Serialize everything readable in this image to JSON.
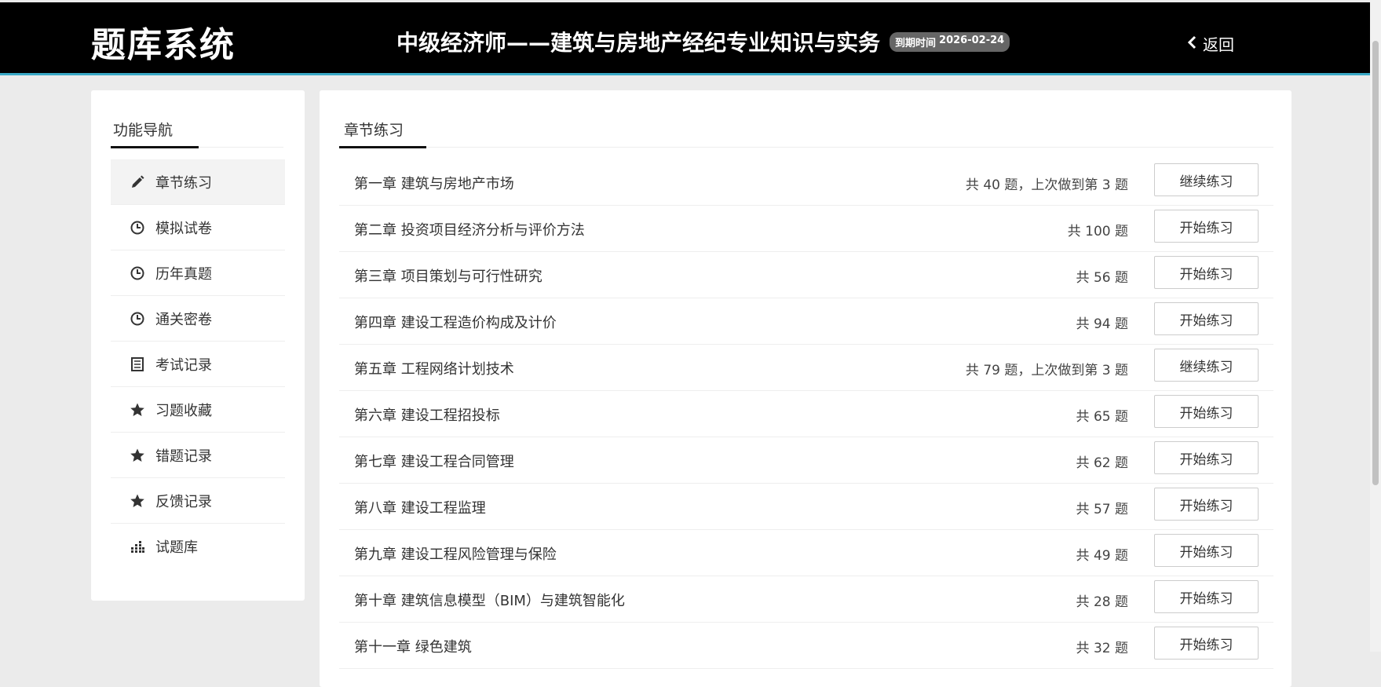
{
  "header": {
    "logo": "题库系统",
    "exam_title": "中级经济师——建筑与房地产经纪专业知识与实务",
    "expiry_label": "到期时间",
    "expiry_date": "2026-02-24",
    "back_label": "返回"
  },
  "sidebar": {
    "title": "功能导航",
    "items": [
      {
        "label": "章节练习",
        "icon": "pencil-icon",
        "active": true
      },
      {
        "label": "模拟试卷",
        "icon": "clock-icon"
      },
      {
        "label": "历年真题",
        "icon": "clock-icon"
      },
      {
        "label": "通关密卷",
        "icon": "clock-icon"
      },
      {
        "label": "考试记录",
        "icon": "list-icon"
      },
      {
        "label": "习题收藏",
        "icon": "star-icon"
      },
      {
        "label": "错题记录",
        "icon": "star-icon"
      },
      {
        "label": "反馈记录",
        "icon": "star-icon"
      },
      {
        "label": "试题库",
        "icon": "grid-icon"
      }
    ]
  },
  "main": {
    "title": "章节练习",
    "chapters": [
      {
        "title": "第一章 建筑与房地产市场",
        "meta": "共 40 题，上次做到第 3 题",
        "button": "继续练习"
      },
      {
        "title": "第二章 投资项目经济分析与评价方法",
        "meta": "共 100 题",
        "button": "开始练习"
      },
      {
        "title": "第三章 项目策划与可行性研究",
        "meta": "共 56 题",
        "button": "开始练习"
      },
      {
        "title": "第四章 建设工程造价构成及计价",
        "meta": "共 94 题",
        "button": "开始练习"
      },
      {
        "title": "第五章 工程网络计划技术",
        "meta": "共 79 题，上次做到第 3 题",
        "button": "继续练习"
      },
      {
        "title": "第六章 建设工程招投标",
        "meta": "共 65 题",
        "button": "开始练习"
      },
      {
        "title": "第七章 建设工程合同管理",
        "meta": "共 62 题",
        "button": "开始练习"
      },
      {
        "title": "第八章 建设工程监理",
        "meta": "共 57 题",
        "button": "开始练习"
      },
      {
        "title": "第九章 建设工程风险管理与保险",
        "meta": "共 49 题",
        "button": "开始练习"
      },
      {
        "title": "第十章 建筑信息模型（BIM）与建筑智能化",
        "meta": "共 28 题",
        "button": "开始练习"
      },
      {
        "title": "第十一章 绿色建筑",
        "meta": "共 32 题",
        "button": "开始练习"
      }
    ]
  },
  "colors": {
    "header_bg": "#000000",
    "header_accent": "#3aa9c6",
    "page_bg": "#ebebeb"
  }
}
